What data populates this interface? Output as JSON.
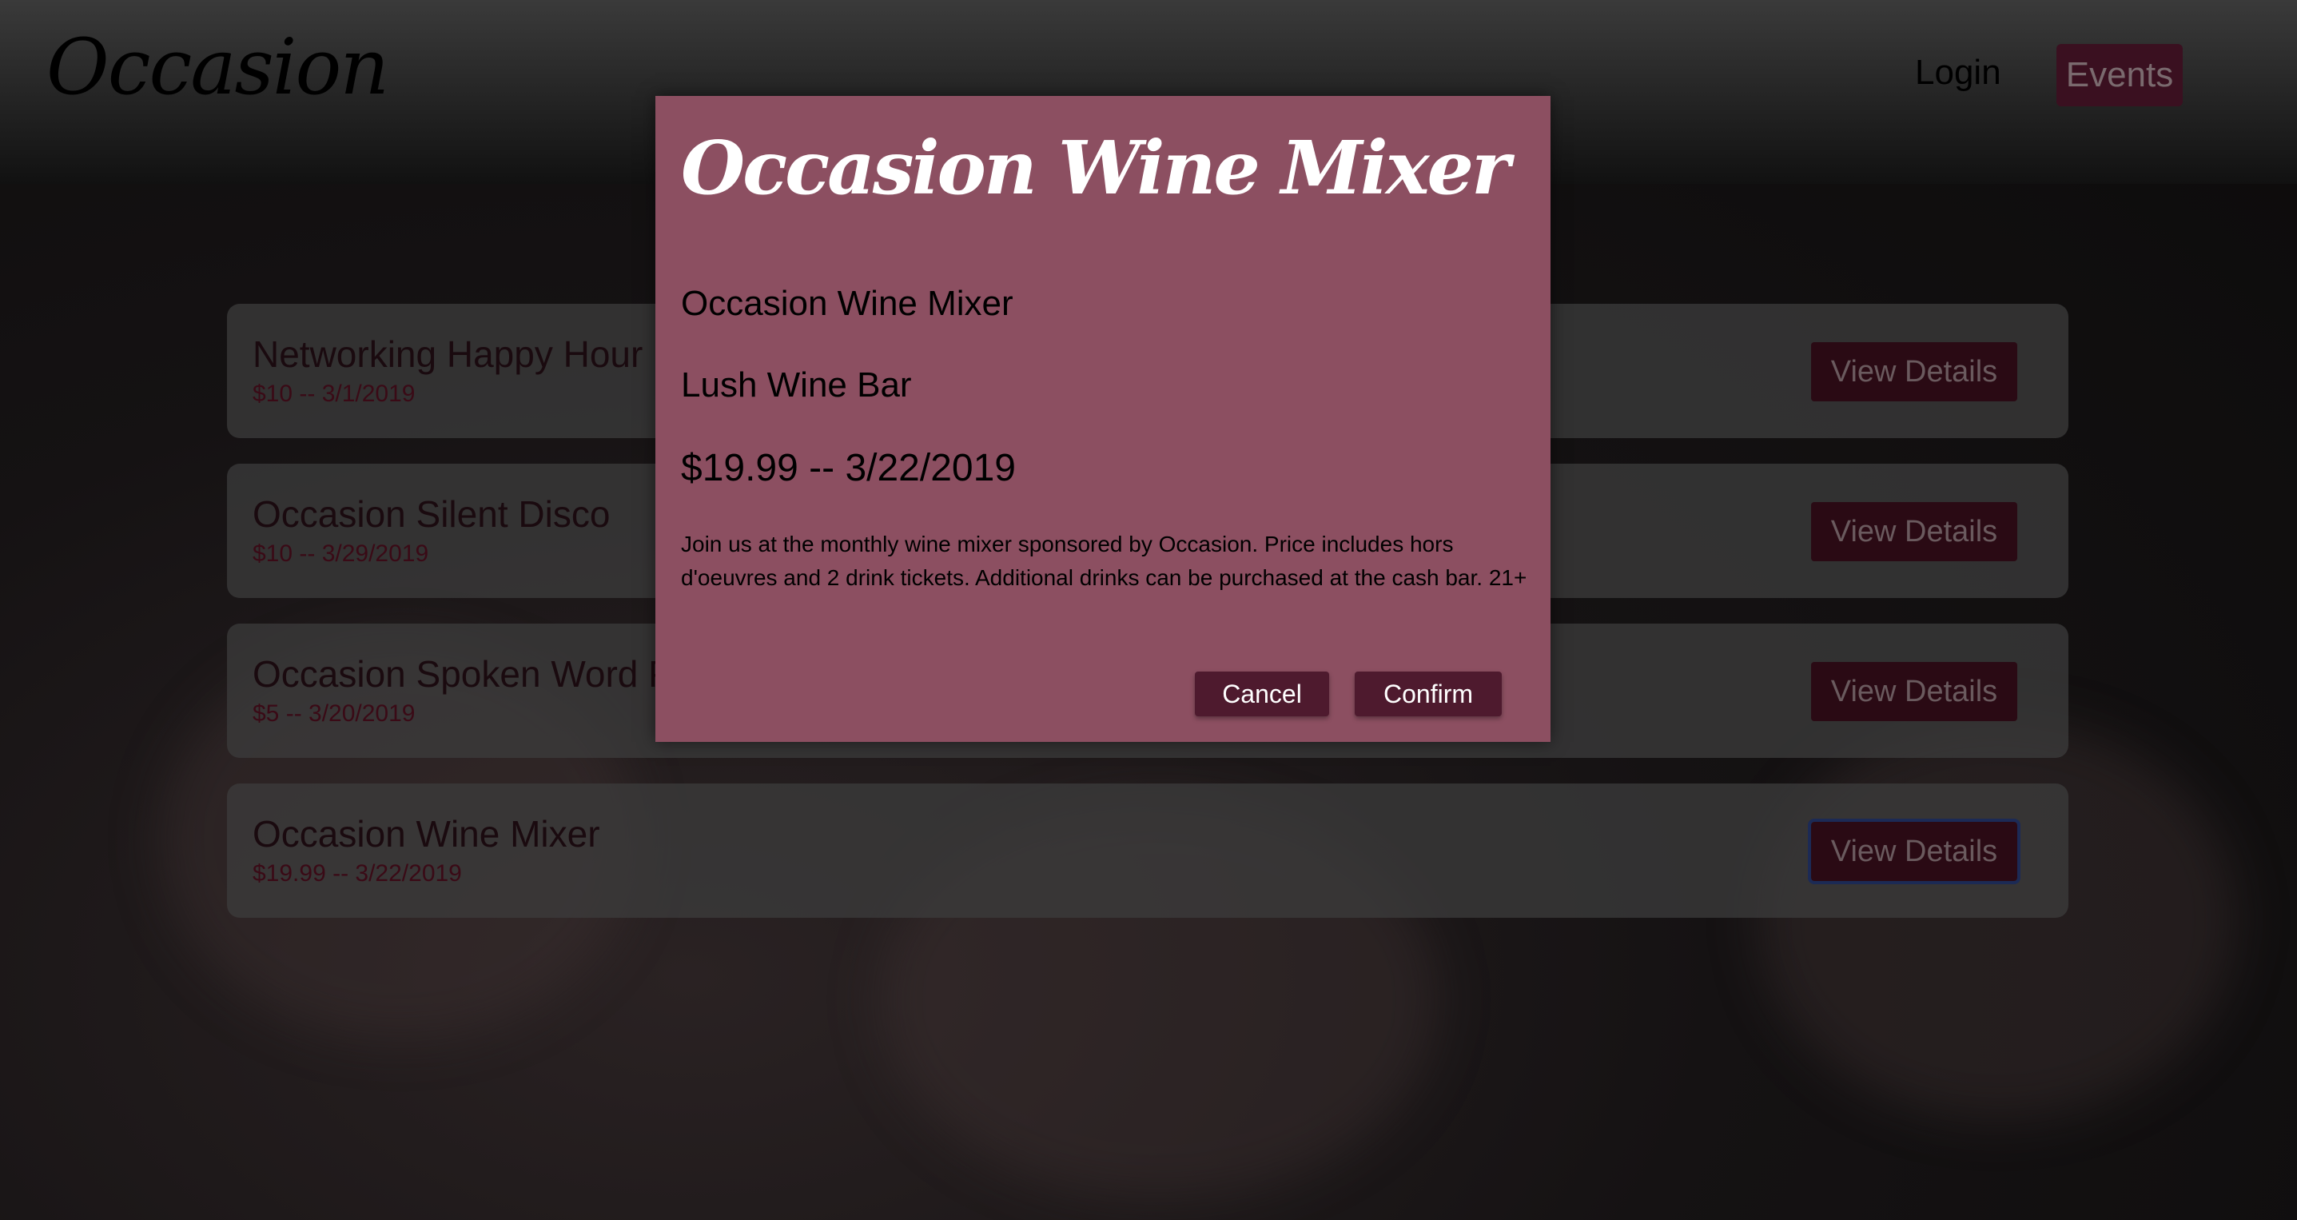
{
  "header": {
    "logo": "Occasion",
    "login": "Login",
    "events": "Events"
  },
  "events": [
    {
      "name": "Networking Happy Hour",
      "meta": "$10 -- 3/1/2019",
      "button": "View Details"
    },
    {
      "name": "Occasion Silent Disco",
      "meta": "$10 -- 3/29/2019",
      "button": "View Details"
    },
    {
      "name": "Occasion Spoken Word Poetry",
      "meta": "$5 -- 3/20/2019",
      "button": "View Details"
    },
    {
      "name": "Occasion Wine Mixer",
      "meta": "$19.99 -- 3/22/2019",
      "button": "View Details"
    }
  ],
  "modal": {
    "title": "Occasion Wine Mixer",
    "name": "Occasion Wine Mixer",
    "venue": "Lush Wine Bar",
    "price_date": "$19.99 -- 3/22/2019",
    "description": "Join us at the monthly wine mixer sponsored by Occasion. Price includes hors d'oeuvres and 2 drink tickets. Additional drinks can be purchased at the cash bar. 21+",
    "cancel": "Cancel",
    "confirm": "Confirm"
  },
  "colors": {
    "modal_bg": "#8c4f61",
    "button_bg": "#4e1a2e"
  }
}
